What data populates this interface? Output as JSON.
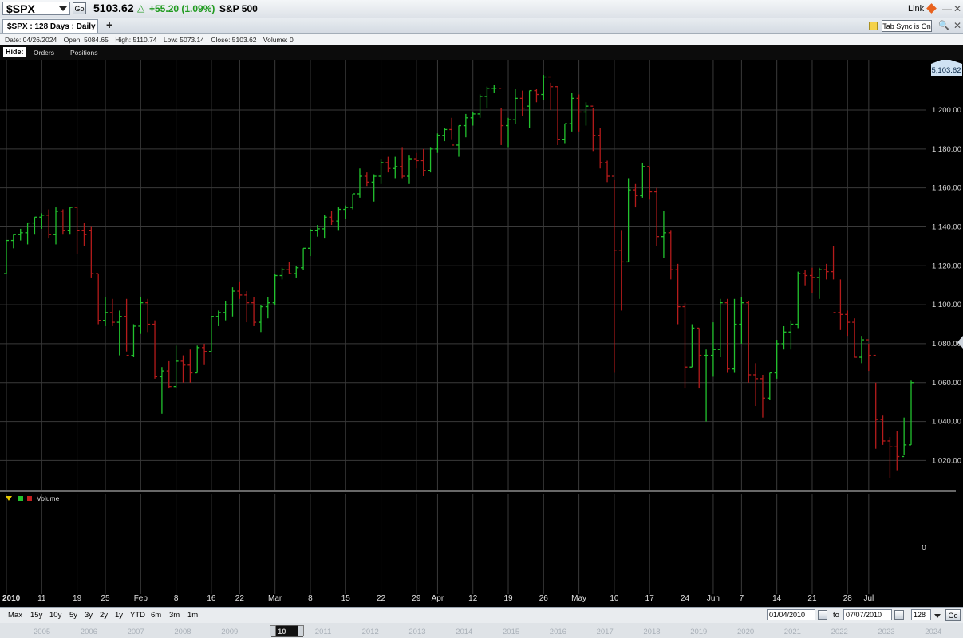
{
  "header": {
    "symbol": "$SPX",
    "go_label": "Go",
    "last_price": "5103.62",
    "change_text": "+55.20 (1.09%)",
    "symbol_name": "S&P 500",
    "link_label": "Link"
  },
  "tabs": {
    "active_label": "$SPX : 128  Days : Daily",
    "add_label": "+",
    "tab_sync_label": "Tab Sync is On"
  },
  "info": {
    "date": "Date: 04/26/2024",
    "open": "Open: 5084.65",
    "high": "High: 5110.74",
    "low": "Low: 5073.14",
    "close": "Close: 5103.62",
    "volume": "Volume: 0"
  },
  "hidebar": {
    "hide_label": "Hide:",
    "orders_label": "Orders",
    "positions_label": "Positions"
  },
  "volume_panel": {
    "label": "Volume",
    "zero_label": "0"
  },
  "colors": {
    "up": "#22c22e",
    "down": "#b51b1b",
    "grid": "#3a3a3a",
    "price_flag": "#cfe2f3"
  },
  "chart_data": {
    "type": "ohlc",
    "last_label": "5,103.62",
    "ylim": [
      1005,
      1225
    ],
    "y_ticks": [
      {
        "v": 1020,
        "label": "1,020.00"
      },
      {
        "v": 1040,
        "label": "1,040.00"
      },
      {
        "v": 1060,
        "label": "1,060.00"
      },
      {
        "v": 1080,
        "label": "1,080.00"
      },
      {
        "v": 1100,
        "label": "1,100.00"
      },
      {
        "v": 1120,
        "label": "1,120.00"
      },
      {
        "v": 1140,
        "label": "1,140.00"
      },
      {
        "v": 1160,
        "label": "1,160.00"
      },
      {
        "v": 1180,
        "label": "1,180.00"
      },
      {
        "v": 1200,
        "label": "1,200.00"
      }
    ],
    "x_ticks": [
      {
        "i": 0,
        "label": "2010"
      },
      {
        "i": 5,
        "label": "11"
      },
      {
        "i": 10,
        "label": "19"
      },
      {
        "i": 14,
        "label": "25"
      },
      {
        "i": 19,
        "label": "Feb"
      },
      {
        "i": 24,
        "label": "8"
      },
      {
        "i": 29,
        "label": "16"
      },
      {
        "i": 33,
        "label": "22"
      },
      {
        "i": 38,
        "label": "Mar"
      },
      {
        "i": 43,
        "label": "8"
      },
      {
        "i": 48,
        "label": "15"
      },
      {
        "i": 53,
        "label": "22"
      },
      {
        "i": 58,
        "label": "29"
      },
      {
        "i": 61,
        "label": "Apr"
      },
      {
        "i": 66,
        "label": "12"
      },
      {
        "i": 71,
        "label": "19"
      },
      {
        "i": 76,
        "label": "26"
      },
      {
        "i": 81,
        "label": "May"
      },
      {
        "i": 86,
        "label": "10"
      },
      {
        "i": 91,
        "label": "17"
      },
      {
        "i": 96,
        "label": "24"
      },
      {
        "i": 100,
        "label": "Jun"
      },
      {
        "i": 104,
        "label": "7"
      },
      {
        "i": 109,
        "label": "14"
      },
      {
        "i": 114,
        "label": "21"
      },
      {
        "i": 119,
        "label": "28"
      },
      {
        "i": 122,
        "label": "Jul"
      }
    ],
    "bars": [
      [
        1116,
        1133,
        1116,
        1133
      ],
      [
        1133,
        1136,
        1129,
        1136
      ],
      [
        1136,
        1139,
        1133,
        1137
      ],
      [
        1137,
        1142,
        1131,
        1142
      ],
      [
        1142,
        1145,
        1136,
        1145
      ],
      [
        1145,
        1147,
        1139,
        1146
      ],
      [
        1146,
        1149,
        1134,
        1136
      ],
      [
        1136,
        1150,
        1131,
        1148
      ],
      [
        1148,
        1149,
        1136,
        1138
      ],
      [
        1138,
        1150,
        1136,
        1150
      ],
      [
        1150,
        1150,
        1126,
        1138
      ],
      [
        1138,
        1142,
        1130,
        1136
      ],
      [
        1138,
        1140,
        1114,
        1116
      ],
      [
        1116,
        1116,
        1090,
        1092
      ],
      [
        1092,
        1104,
        1089,
        1096
      ],
      [
        1096,
        1103,
        1089,
        1091
      ],
      [
        1091,
        1097,
        1074,
        1094
      ],
      [
        1094,
        1103,
        1076,
        1074
      ],
      [
        1074,
        1090,
        1073,
        1089
      ],
      [
        1089,
        1104,
        1085,
        1101
      ],
      [
        1101,
        1103,
        1086,
        1090
      ],
      [
        1090,
        1092,
        1062,
        1063
      ],
      [
        1063,
        1068,
        1044,
        1066
      ],
      [
        1066,
        1071,
        1057,
        1058
      ],
      [
        1058,
        1079,
        1057,
        1071
      ],
      [
        1071,
        1074,
        1060,
        1069
      ],
      [
        1069,
        1077,
        1060,
        1065
      ],
      [
        1065,
        1079,
        1065,
        1078
      ],
      [
        1078,
        1080,
        1069,
        1076
      ],
      [
        1076,
        1094,
        1076,
        1094
      ],
      [
        1094,
        1097,
        1089,
        1096
      ],
      [
        1096,
        1102,
        1092,
        1100
      ],
      [
        1100,
        1109,
        1094,
        1107
      ],
      [
        1107,
        1112,
        1103,
        1105
      ],
      [
        1105,
        1107,
        1091,
        1101
      ],
      [
        1101,
        1104,
        1089,
        1091
      ],
      [
        1091,
        1100,
        1086,
        1099
      ],
      [
        1099,
        1104,
        1093,
        1101
      ],
      [
        1101,
        1116,
        1100,
        1115
      ],
      [
        1115,
        1119,
        1113,
        1118
      ],
      [
        1118,
        1122,
        1116,
        1116
      ],
      [
        1116,
        1120,
        1114,
        1119
      ],
      [
        1119,
        1129,
        1118,
        1129
      ],
      [
        1129,
        1139,
        1125,
        1138
      ],
      [
        1138,
        1141,
        1135,
        1139
      ],
      [
        1139,
        1146,
        1134,
        1145
      ],
      [
        1145,
        1148,
        1141,
        1143
      ],
      [
        1143,
        1150,
        1138,
        1149
      ],
      [
        1149,
        1151,
        1144,
        1150
      ],
      [
        1150,
        1157,
        1149,
        1157
      ],
      [
        1157,
        1170,
        1155,
        1166
      ],
      [
        1166,
        1168,
        1161,
        1163
      ],
      [
        1163,
        1167,
        1153,
        1166
      ],
      [
        1166,
        1175,
        1162,
        1173
      ],
      [
        1173,
        1176,
        1168,
        1170
      ],
      [
        1170,
        1176,
        1165,
        1171
      ],
      [
        1171,
        1181,
        1165,
        1166
      ],
      [
        1166,
        1177,
        1162,
        1175
      ],
      [
        1175,
        1178,
        1170,
        1174
      ],
      [
        1174,
        1180,
        1166,
        1169
      ],
      [
        1169,
        1181,
        1168,
        1180
      ],
      [
        1180,
        1188,
        1178,
        1187
      ],
      [
        1187,
        1191,
        1184,
        1190
      ],
      [
        1190,
        1196,
        1185,
        1182
      ],
      [
        1182,
        1192,
        1176,
        1192
      ],
      [
        1192,
        1198,
        1186,
        1196
      ],
      [
        1196,
        1199,
        1192,
        1198
      ],
      [
        1198,
        1208,
        1196,
        1207
      ],
      [
        1207,
        1212,
        1201,
        1211
      ],
      [
        1211,
        1213,
        1209,
        1211
      ],
      [
        1211,
        1201,
        1182,
        1192
      ],
      [
        1192,
        1196,
        1181,
        1195
      ],
      [
        1195,
        1211,
        1193,
        1206
      ],
      [
        1206,
        1210,
        1197,
        1201
      ],
      [
        1202,
        1210,
        1191,
        1210
      ],
      [
        1210,
        1211,
        1204,
        1208
      ],
      [
        1208,
        1218,
        1205,
        1217
      ],
      [
        1217,
        1214,
        1200,
        1212
      ],
      [
        1212,
        1212,
        1182,
        1185
      ],
      [
        1185,
        1193,
        1183,
        1193
      ],
      [
        1193,
        1209,
        1189,
        1206
      ],
      [
        1206,
        1208,
        1189,
        1199
      ],
      [
        1199,
        1204,
        1192,
        1202
      ],
      [
        1202,
        1201,
        1179,
        1187
      ],
      [
        1187,
        1191,
        1170,
        1173
      ],
      [
        1173,
        1174,
        1163,
        1166
      ],
      [
        1166,
        1164,
        1065,
        1128
      ],
      [
        1128,
        1138,
        1097,
        1122
      ],
      [
        1122,
        1165,
        1122,
        1159
      ],
      [
        1159,
        1162,
        1150,
        1156
      ],
      [
        1156,
        1173,
        1155,
        1171
      ],
      [
        1171,
        1171,
        1154,
        1158
      ],
      [
        1158,
        1160,
        1130,
        1135
      ],
      [
        1135,
        1148,
        1124,
        1137
      ],
      [
        1137,
        1138,
        1113,
        1118
      ],
      [
        1118,
        1121,
        1090,
        1099
      ],
      [
        1099,
        1101,
        1057,
        1068
      ],
      [
        1068,
        1090,
        1068,
        1088
      ],
      [
        1088,
        1088,
        1057,
        1074
      ],
      [
        1074,
        1077,
        1040,
        1074
      ],
      [
        1074,
        1091,
        1063,
        1077
      ],
      [
        1077,
        1103,
        1073,
        1101
      ],
      [
        1101,
        1103,
        1065,
        1067
      ],
      [
        1067,
        1103,
        1065,
        1090
      ],
      [
        1090,
        1104,
        1080,
        1101
      ],
      [
        1101,
        1102,
        1060,
        1064
      ],
      [
        1064,
        1070,
        1048,
        1062
      ],
      [
        1062,
        1064,
        1042,
        1052
      ],
      [
        1052,
        1065,
        1051,
        1065
      ],
      [
        1065,
        1082,
        1062,
        1080
      ],
      [
        1080,
        1089,
        1077,
        1086
      ],
      [
        1086,
        1092,
        1077,
        1090
      ],
      [
        1090,
        1117,
        1088,
        1116
      ],
      [
        1116,
        1118,
        1110,
        1115
      ],
      [
        1115,
        1119,
        1106,
        1114
      ],
      [
        1114,
        1119,
        1103,
        1118
      ],
      [
        1118,
        1121,
        1113,
        1117
      ],
      [
        1117,
        1130,
        1113,
        1096
      ],
      [
        1096,
        1113,
        1087,
        1095
      ],
      [
        1095,
        1097,
        1084,
        1091
      ],
      [
        1091,
        1093,
        1073,
        1073
      ],
      [
        1073,
        1084,
        1070,
        1082
      ],
      [
        1082,
        1080,
        1066,
        1074
      ],
      [
        1074,
        1060,
        1026,
        1041
      ],
      [
        1041,
        1043,
        1028,
        1030
      ],
      [
        1030,
        1032,
        1011,
        1027
      ],
      [
        1027,
        1035,
        1015,
        1022
      ],
      [
        1022,
        1042,
        1023,
        1028
      ],
      [
        1028,
        1061,
        1028,
        1060
      ]
    ]
  },
  "bottom": {
    "ranges": [
      "Max",
      "15y",
      "10y",
      "5y",
      "3y",
      "2y",
      "1y",
      "YTD",
      "6m",
      "3m",
      "1m"
    ],
    "from_date": "01/04/2010",
    "to_label": "to",
    "to_date": "07/07/2010",
    "days": "128",
    "go_label": "Go"
  },
  "navigator": {
    "years": [
      "2005",
      "2006",
      "2007",
      "2008",
      "2009",
      "2011",
      "2012",
      "2013",
      "2014",
      "2015",
      "2016",
      "2017",
      "2018",
      "2019",
      "2020",
      "2021",
      "2022",
      "2023",
      "2024"
    ],
    "thumb_label": "10"
  }
}
